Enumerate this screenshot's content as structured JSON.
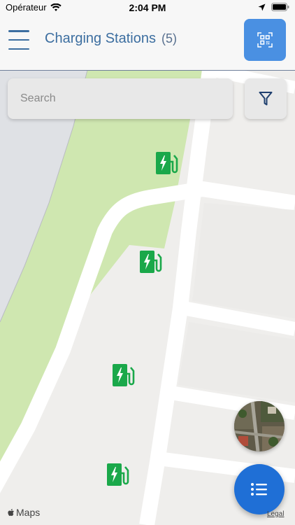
{
  "status_bar": {
    "carrier": "Opérateur",
    "time": "2:04 PM"
  },
  "nav": {
    "title": "Charging Stations",
    "count": "(5)",
    "accent_color": "#3c6ea0",
    "qr_button_color": "#4a90e2"
  },
  "search": {
    "placeholder": "Search"
  },
  "map": {
    "stations": [
      "charging-station",
      "charging-station",
      "charging-station",
      "charging-station"
    ],
    "station_color": "#1aa84a",
    "attribution": "Maps",
    "legal": "Legal"
  },
  "icons": {
    "menu": "hamburger-menu-icon",
    "qr": "qr-scan-icon",
    "filter": "filter-funnel-icon",
    "list": "list-icon",
    "satellite": "satellite-view-thumbnail"
  }
}
